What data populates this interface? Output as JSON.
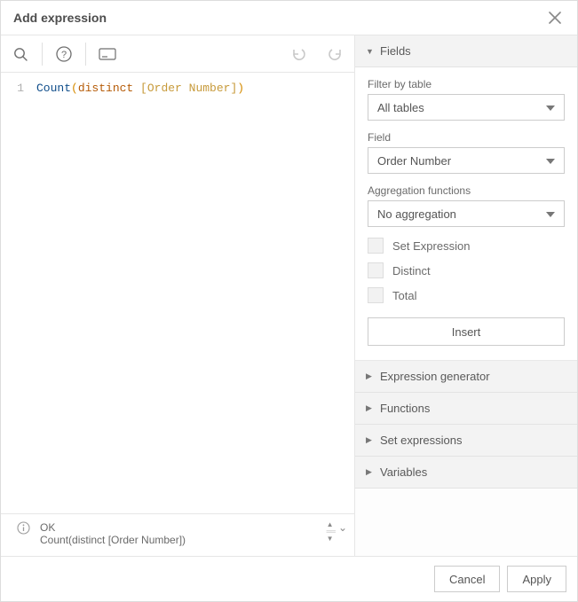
{
  "header": {
    "title": "Add expression"
  },
  "editor": {
    "line_number": "1",
    "tok_fn": "Count",
    "tok_open": "(",
    "tok_kw": "distinct ",
    "tok_field": "[Order Number]",
    "tok_close": ")"
  },
  "status": {
    "ok": "OK",
    "preview": "Count(distinct [Order Number])"
  },
  "panel": {
    "sections": {
      "fields": "Fields",
      "expression_generator": "Expression generator",
      "functions": "Functions",
      "set_expressions": "Set expressions",
      "variables": "Variables"
    },
    "fields_body": {
      "filter_label": "Filter by table",
      "filter_value": "All tables",
      "field_label": "Field",
      "field_value": "Order Number",
      "agg_label": "Aggregation functions",
      "agg_value": "No aggregation",
      "chk_set": "Set Expression",
      "chk_distinct": "Distinct",
      "chk_total": "Total",
      "insert": "Insert"
    }
  },
  "footer": {
    "cancel": "Cancel",
    "apply": "Apply"
  }
}
